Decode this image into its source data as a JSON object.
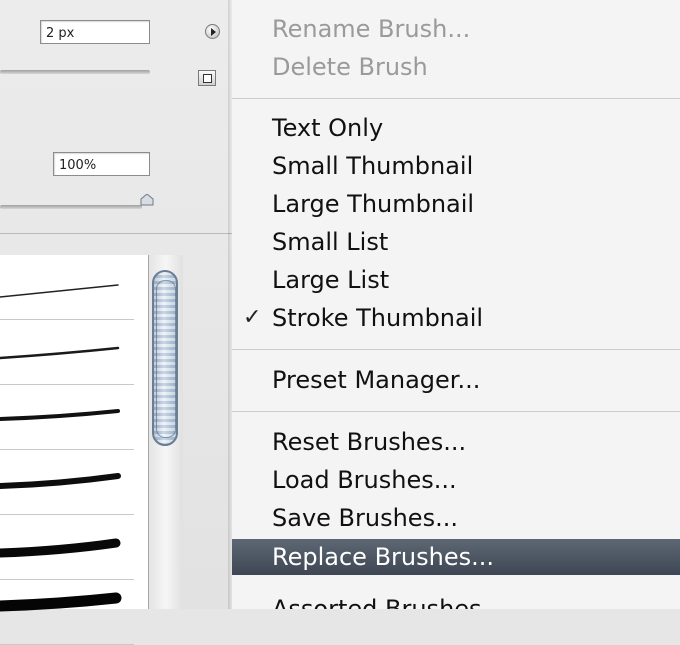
{
  "brush_panel": {
    "size_value": "2 px",
    "hardness_value": "100%",
    "hardness_level_percent": 100,
    "brush_preset_count_visible": 6
  },
  "menu": {
    "items": [
      {
        "label": "Rename Brush...",
        "enabled": false
      },
      {
        "label": "Delete Brush",
        "enabled": false
      },
      {
        "label": "Text Only",
        "enabled": true
      },
      {
        "label": "Small Thumbnail",
        "enabled": true
      },
      {
        "label": "Large Thumbnail",
        "enabled": true
      },
      {
        "label": "Small List",
        "enabled": true
      },
      {
        "label": "Large List",
        "enabled": true
      },
      {
        "label": "Stroke Thumbnail",
        "enabled": true,
        "checked": true
      },
      {
        "label": "Preset Manager...",
        "enabled": true
      },
      {
        "label": "Reset Brushes...",
        "enabled": true
      },
      {
        "label": "Load Brushes...",
        "enabled": true
      },
      {
        "label": "Save Brushes...",
        "enabled": true
      },
      {
        "label": "Replace Brushes...",
        "enabled": true,
        "highlighted": true
      },
      {
        "label": "Assorted Brushes",
        "enabled": true
      }
    ],
    "checkmark_glyph": "✓",
    "highlight_color": "#4a5461"
  }
}
